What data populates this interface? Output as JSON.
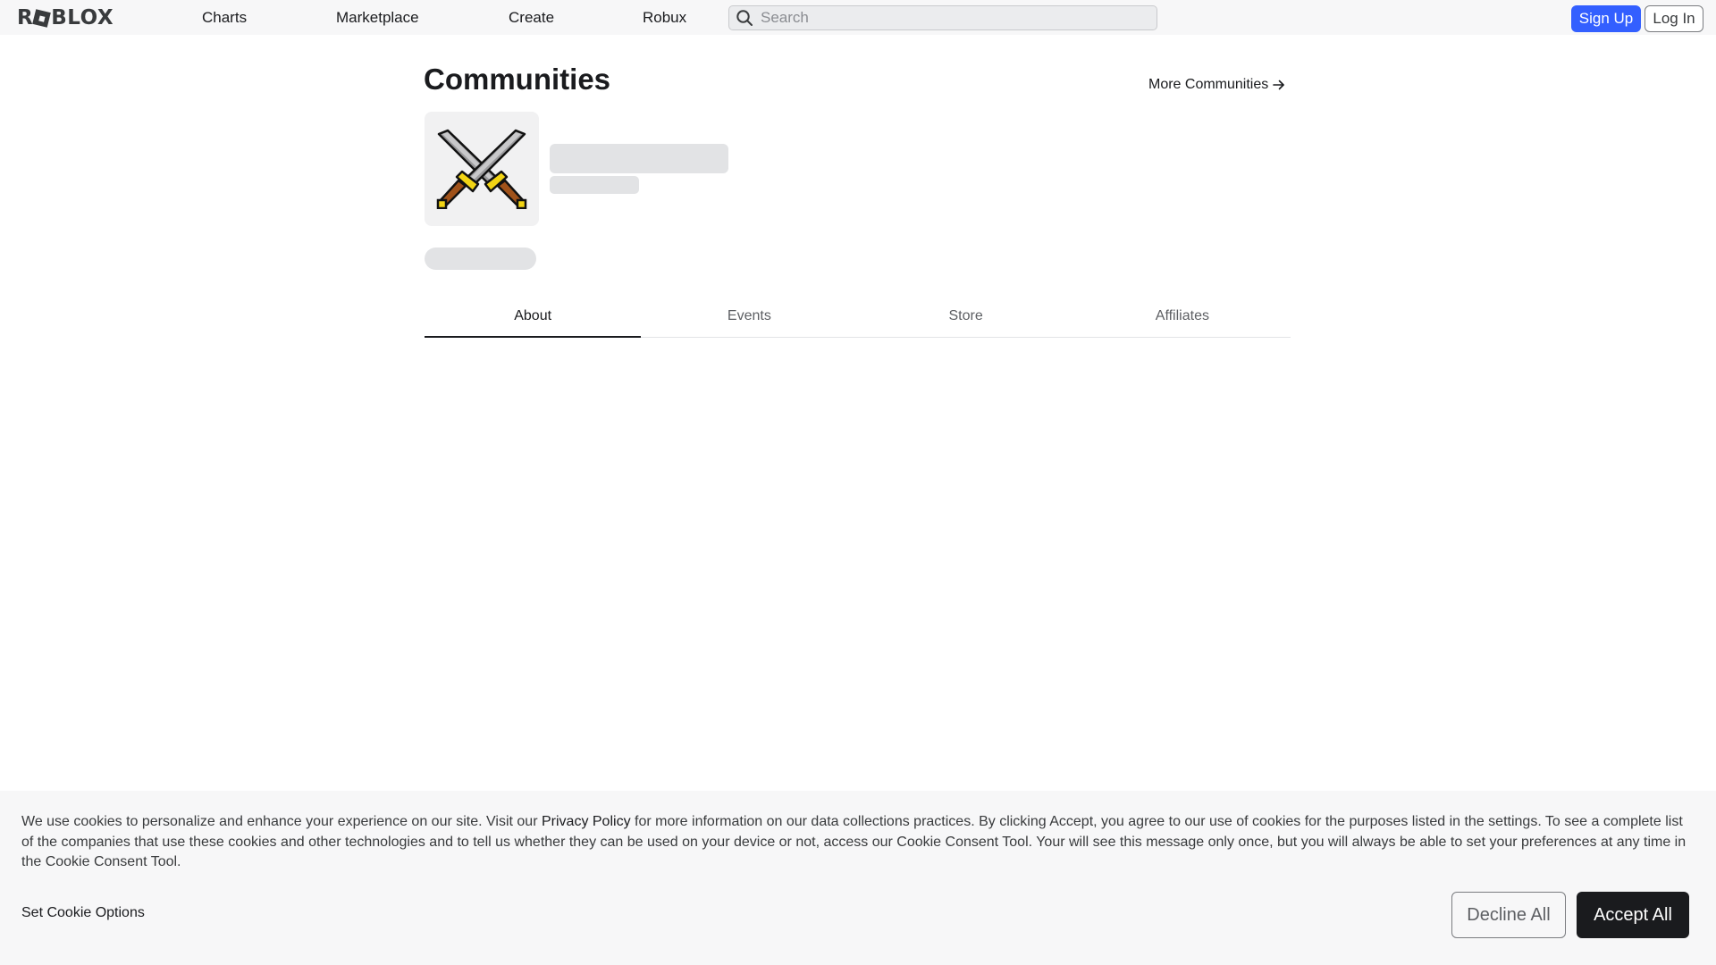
{
  "header": {
    "logo_text_1": "R",
    "logo_text_2": "BLOX",
    "nav": [
      "Charts",
      "Marketplace",
      "Create",
      "Robux"
    ],
    "search_placeholder": "Search",
    "signup_label": "Sign Up",
    "login_label": "Log In"
  },
  "main": {
    "title": "Communities",
    "more_link": "More Communities",
    "tabs": [
      "About",
      "Events",
      "Store",
      "Affiliates"
    ],
    "active_tab": "About"
  },
  "cookie_banner": {
    "text_before": "We use cookies to personalize and enhance your experience on our site. Visit our ",
    "privacy_link": "Privacy Policy",
    "text_after": " for more information on our data collections practices. By clicking Accept, you agree to our use of cookies for the purposes listed in the settings. To see a complete list of the companies that use these cookies and other technologies and to tell us whether they can be used on your device or not, access our Cookie Consent Tool. Your will see this message only once, but you will always be able to set your preferences at any time in the Cookie Consent Tool.",
    "options_label": "Set Cookie Options",
    "decline_label": "Decline All",
    "accept_label": "Accept All"
  },
  "colors": {
    "brand_blue": "#335fff",
    "topbar_bg": "#f7f7f8",
    "skeleton": "#e2e3e5",
    "dark_button": "#1a1b1e"
  },
  "icons": {
    "search": "search-icon",
    "arrow": "arrow-right-icon",
    "group": "crossed-swords-icon"
  }
}
